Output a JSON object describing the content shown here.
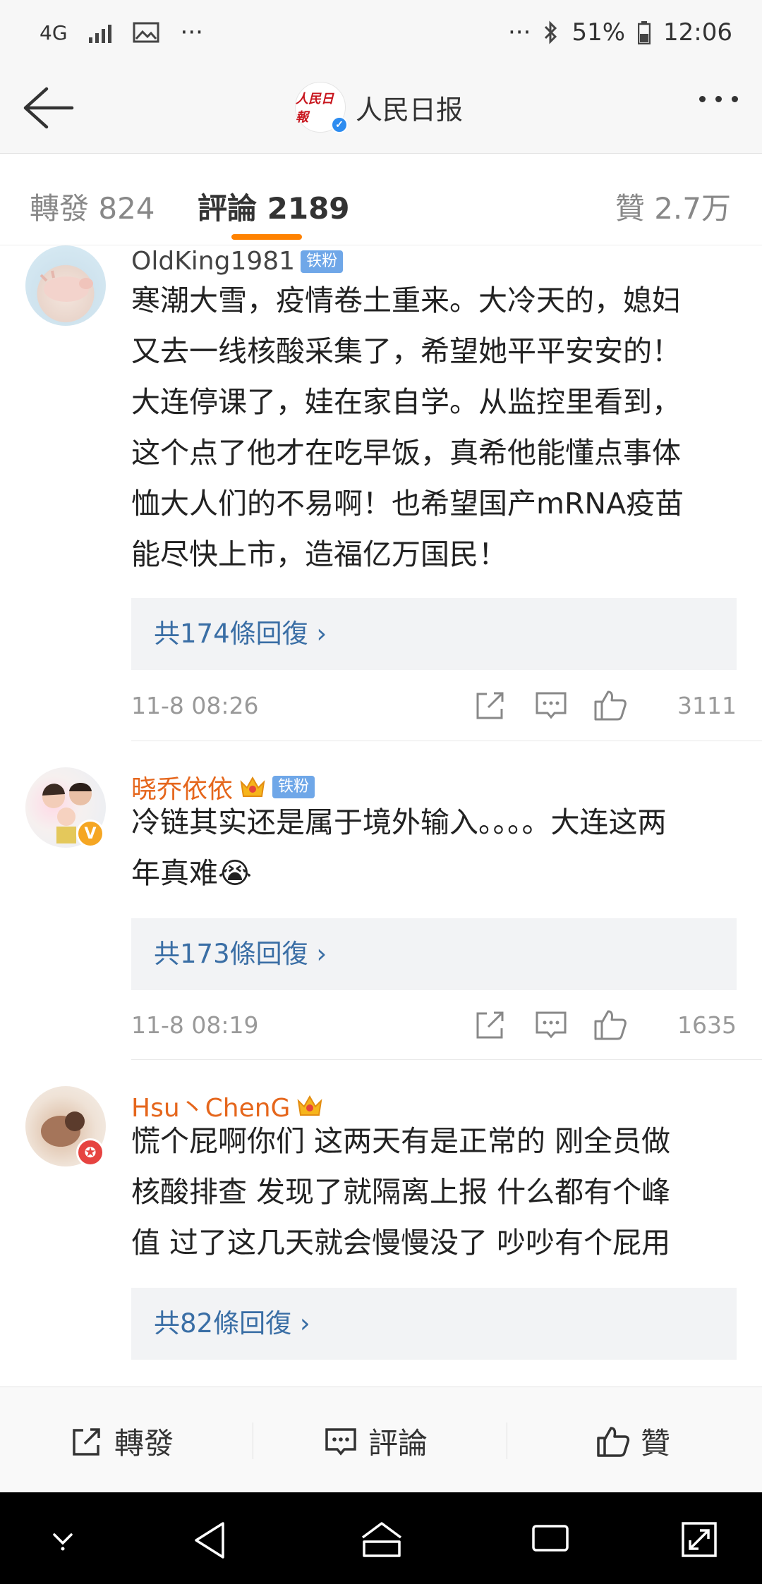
{
  "status_bar": {
    "network": "4G",
    "dots": "···",
    "more": "···",
    "battery": "51%",
    "time": "12:06"
  },
  "header": {
    "title": "人民日报",
    "logo_text": "人民日報"
  },
  "tabs": [
    {
      "label": "轉發 824"
    },
    {
      "label": "評論 2189"
    },
    {
      "label": "贊 2.7万"
    }
  ],
  "comments": [
    {
      "user": "OldKing1981",
      "tag": "铁粉",
      "lines": [
        "寒潮大雪，疫情卷土重来。大冷天的，媳妇",
        "又去一线核酸采集了，希望她平平安安的！",
        "大连停课了，娃在家自学。从监控里看到，",
        "这个点了他才在吃早饭，真希他能懂点事体",
        "恤大人们的不易啊！也希望国产mRNA疫苗",
        "能尽快上市，造福亿万国民！"
      ],
      "replies": "共174條回復 ›",
      "time": "11-8 08:26",
      "likes": "3111"
    },
    {
      "user": "晓乔依依",
      "tag": "铁粉",
      "lines": [
        "冷链其实还是属于境外输入。。。。大连这两",
        "年真难😭"
      ],
      "replies": "共173條回復 ›",
      "time": "11-8 08:19",
      "likes": "1635"
    },
    {
      "user": "Hsu丶ChenG",
      "lines": [
        "慌个屁啊你们 这两天有是正常的 刚全员做",
        "核酸排查 发现了就隔离上报 什么都有个峰",
        "值 过了这几天就会慢慢没了 吵吵有个屁用"
      ],
      "replies": "共82條回復 ›"
    }
  ],
  "bottom_bar": {
    "repost": "轉發",
    "comment": "評論",
    "like": "贊"
  },
  "colors": {
    "accent": "#ff8200",
    "link": "#3a6ea5",
    "username_vip": "#e5661c",
    "fan_tag": "#6fa7e8"
  }
}
